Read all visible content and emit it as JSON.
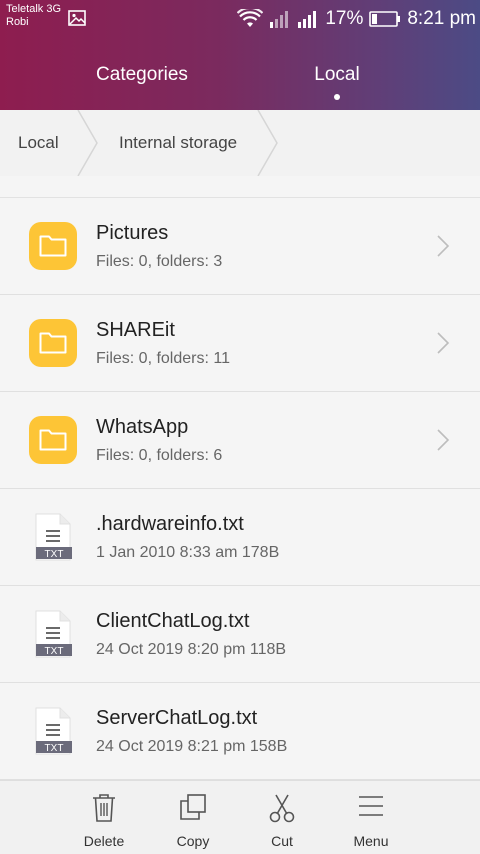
{
  "status_bar": {
    "carrier_line1": "Teletalk 3G",
    "carrier_line2": "Robi",
    "battery_percent": "17%",
    "time": "8:21 pm"
  },
  "tabs": [
    {
      "label": "Categories",
      "active": false
    },
    {
      "label": "Local",
      "active": true
    }
  ],
  "breadcrumb": [
    "Local",
    "Internal storage"
  ],
  "items": [
    {
      "type": "folder",
      "name": "Pictures",
      "meta": "Files: 0, folders: 3",
      "icon": "folder-icon"
    },
    {
      "type": "folder",
      "name": "SHAREit",
      "meta": "Files: 0, folders: 11",
      "icon": "folder-icon"
    },
    {
      "type": "folder",
      "name": "WhatsApp",
      "meta": "Files: 0, folders: 6",
      "icon": "folder-icon"
    },
    {
      "type": "file",
      "name": ".hardwareinfo.txt",
      "meta": "1 Jan 2010 8:33 am 178B",
      "ext": "TXT",
      "icon": "txt-file-icon"
    },
    {
      "type": "file",
      "name": "ClientChatLog.txt",
      "meta": "24 Oct 2019 8:20 pm 118B",
      "ext": "TXT",
      "icon": "txt-file-icon"
    },
    {
      "type": "file",
      "name": "ServerChatLog.txt",
      "meta": "24 Oct 2019 8:21 pm 158B",
      "ext": "TXT",
      "icon": "txt-file-icon"
    }
  ],
  "toolbar": {
    "delete_label": "Delete",
    "copy_label": "Copy",
    "cut_label": "Cut",
    "menu_label": "Menu"
  },
  "colors": {
    "folder": "#fdc536",
    "header_start": "#8e1d4f",
    "header_end": "#4c4b85"
  }
}
